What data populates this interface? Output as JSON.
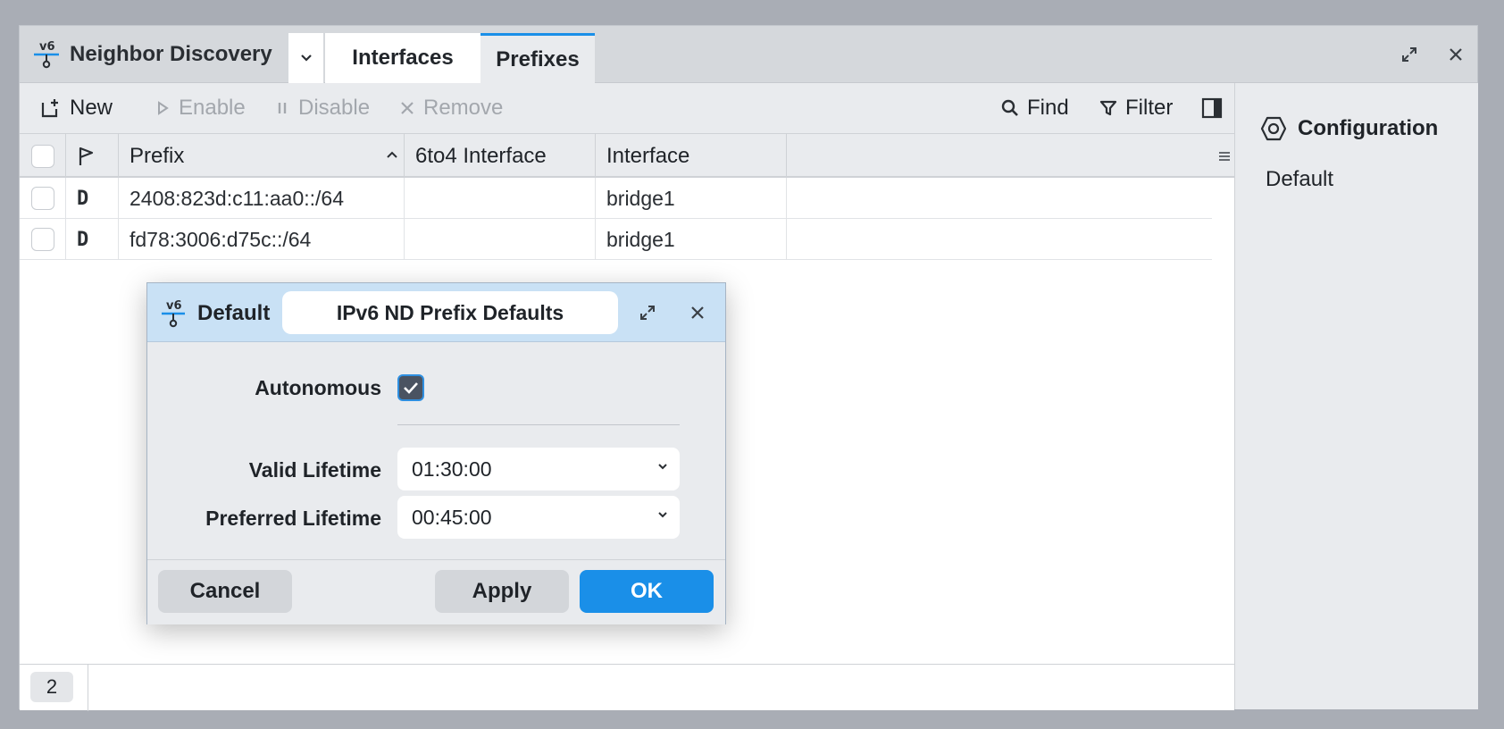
{
  "window": {
    "title": "Neighbor Discovery",
    "tabs": [
      {
        "label": "Interfaces"
      },
      {
        "label": "Prefixes",
        "active": true
      }
    ]
  },
  "toolbar": {
    "new_label": "New",
    "enable_label": "Enable",
    "disable_label": "Disable",
    "remove_label": "Remove",
    "find_label": "Find",
    "filter_label": "Filter"
  },
  "table": {
    "columns": [
      "Prefix",
      "6to4 Interface",
      "Interface"
    ],
    "sort_column": "Prefix",
    "rows": [
      {
        "flag": "D",
        "prefix": "2408:823d:c11:aa0::/64",
        "six_to_four": "",
        "interface": "bridge1"
      },
      {
        "flag": "D",
        "prefix": "fd78:3006:d75c::/64",
        "six_to_four": "",
        "interface": "bridge1"
      }
    ]
  },
  "status": {
    "count": "2"
  },
  "side_panel": {
    "title": "Configuration",
    "items": [
      "Default"
    ]
  },
  "dialog": {
    "name": "Default",
    "title": "IPv6 ND Prefix Defaults",
    "autonomous_label": "Autonomous",
    "autonomous_checked": true,
    "valid_lifetime_label": "Valid Lifetime",
    "valid_lifetime_value": "01:30:00",
    "preferred_lifetime_label": "Preferred Lifetime",
    "preferred_lifetime_value": "00:45:00",
    "cancel_label": "Cancel",
    "apply_label": "Apply",
    "ok_label": "OK"
  },
  "colors": {
    "accent": "#1a8fe8",
    "dialog_header": "#c9e1f5",
    "toolbar_bg": "#e9ebee",
    "backdrop": "#a9adb5"
  },
  "icons": {
    "app": "ipv6-icon",
    "new": "new-item-icon",
    "enable": "play-icon",
    "disable": "pause-icon",
    "remove": "x-icon",
    "find": "search-icon",
    "filter": "filter-icon",
    "panel": "sidebar-toggle-icon",
    "configuration": "hexagon-icon"
  }
}
